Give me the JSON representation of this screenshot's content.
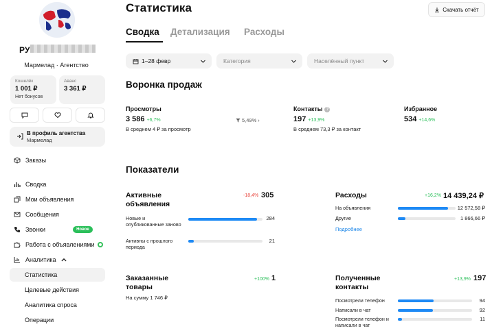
{
  "user": {
    "name_visible": "РУ",
    "agency": "Мармелад · Агентство"
  },
  "wallets": [
    {
      "caption": "Кошелёк",
      "value": "1 001 ₽",
      "sub": "Нет бонусов"
    },
    {
      "caption": "Аванс",
      "value": "3 361 ₽",
      "sub": ""
    }
  ],
  "profile": {
    "line1": "В профиль агентства",
    "line2": "Мармелад"
  },
  "nav": {
    "orders": "Заказы",
    "summary": "Сводка",
    "my_ads": "Мои объявления",
    "messages": "Сообщения",
    "calls": "Звонки",
    "calls_badge": "Новое",
    "work_with_ads": "Работа с объявлениями",
    "analytics": "Аналитика",
    "statistics": "Статистика",
    "target_actions": "Целевые действия",
    "demand_analytics": "Аналитика спроса",
    "operations": "Операции"
  },
  "header": {
    "title": "Статистика",
    "download": "Скачать отчёт"
  },
  "tabs": [
    "Сводка",
    "Детализация",
    "Расходы"
  ],
  "filters": {
    "period": "1–28 февр",
    "category": "Категория",
    "city": "Населённый пункт"
  },
  "funnel": {
    "title": "Воронка продаж",
    "views": {
      "label": "Просмотры",
      "value": "3 586",
      "delta": "+6,7%",
      "note": "В среднем 4 ₽ за просмотр"
    },
    "conversion": "5,49%",
    "contacts": {
      "label": "Контакты",
      "value": "197",
      "delta": "+13,9%",
      "note": "В среднем 73,3 ₽ за контакт"
    },
    "favorites": {
      "label": "Избранное",
      "value": "534",
      "delta": "+14,6%"
    }
  },
  "indicators": {
    "title": "Показатели",
    "active": {
      "label": "Активные объявления",
      "delta": "-18,4%",
      "value": "305",
      "rows": [
        {
          "label": "Новые и опубликованные заново",
          "value": "284",
          "share": 0.93
        },
        {
          "label": "Активны с прошлого периода",
          "value": "21",
          "share": 0.07
        }
      ]
    },
    "expenses": {
      "label": "Расходы",
      "delta": "+16,2%",
      "value": "14 439,24 ₽",
      "rows": [
        {
          "label": "На объявления",
          "value": "12 572,58 ₽",
          "share": 0.87
        },
        {
          "label": "Другие",
          "value": "1 866,66 ₽",
          "share": 0.13
        }
      ],
      "more": "Подробнее"
    },
    "ordered": {
      "label": "Заказанные товары",
      "delta": "+100%",
      "value": "1",
      "note": "На сумму 1 746 ₽"
    },
    "contacts": {
      "label": "Полученные контакты",
      "delta": "+13,9%",
      "value": "197",
      "rows": [
        {
          "label": "Посмотрели телефон",
          "value": "94",
          "share": 0.48
        },
        {
          "label": "Написали в чат",
          "value": "92",
          "share": 0.47
        },
        {
          "label": "Посмотрели телефон и написали в чат",
          "value": "11",
          "share": 0.06
        }
      ]
    }
  },
  "colors": {
    "accent": "#1e8af5",
    "positive": "#2bbf5a",
    "negative": "#e8453c",
    "badge": "#2bbf5a"
  },
  "icons": [
    "globe-avatar",
    "chat-icon",
    "heart-icon",
    "bell-icon",
    "login-arrow-icon",
    "cube-icon",
    "bar-chart-icon",
    "copy-icon",
    "mail-icon",
    "phone-icon",
    "puzzle-icon",
    "chart-icon",
    "chevron-down-icon",
    "chevron-up-icon",
    "download-icon",
    "calendar-icon",
    "funnel-icon",
    "info-icon"
  ]
}
